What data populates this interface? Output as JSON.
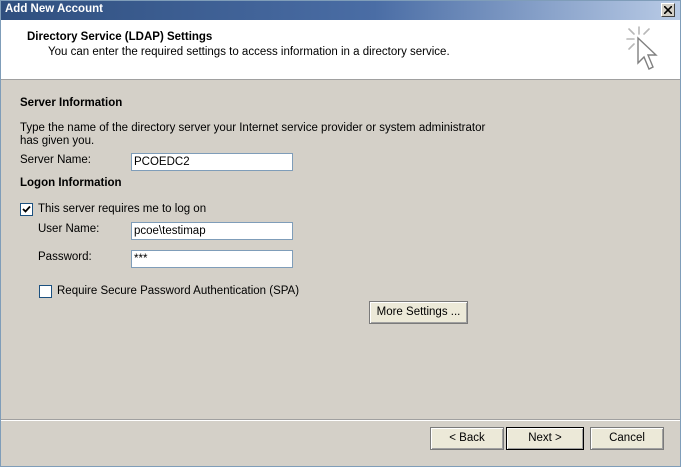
{
  "window": {
    "title": "Add New Account",
    "close_label": "close"
  },
  "header": {
    "title": "Directory Service (LDAP) Settings",
    "subtitle": "You can enter the required settings to access information in a directory service.",
    "icon": "cursor-sparkle-icon"
  },
  "server_info": {
    "heading": "Server Information",
    "description_line1": "Type the name of the directory server your Internet service provider or system administrator",
    "description_line2": "has given you.",
    "server_name_label": "Server Name:",
    "server_name_value": "PCOEDC2"
  },
  "logon_info": {
    "heading": "Logon Information",
    "requires_logon_label": "This server requires me to log on",
    "requires_logon_checked": true,
    "user_name_label": "User Name:",
    "user_name_value": "pcoe\\testimap",
    "password_label": "Password:",
    "password_value": "***",
    "spa_label": "Require Secure Password Authentication (SPA)",
    "spa_checked": false
  },
  "buttons": {
    "more_settings": "More Settings ...",
    "back": "< Back",
    "next": "Next >",
    "cancel": "Cancel"
  }
}
